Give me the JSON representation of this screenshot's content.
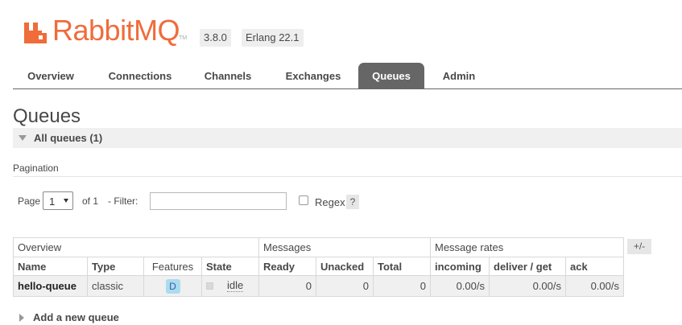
{
  "header": {
    "brand": "RabbitMQ",
    "trademark": "TM",
    "version": "3.8.0",
    "erlang": "Erlang 22.1",
    "brand_color": "#ef6c3b"
  },
  "tabs": [
    {
      "label": "Overview"
    },
    {
      "label": "Connections"
    },
    {
      "label": "Channels"
    },
    {
      "label": "Exchanges"
    },
    {
      "label": "Queues",
      "active": true
    },
    {
      "label": "Admin"
    }
  ],
  "page": {
    "title": "Queues",
    "section_label": "All queues (1)",
    "pagination_label": "Pagination"
  },
  "filter": {
    "page_label": "Page",
    "page_value": "1",
    "of_text": "of 1",
    "filter_label": "- Filter:",
    "filter_value": "",
    "regex_label": "Regex",
    "help_label": "?"
  },
  "table": {
    "groups": [
      "Overview",
      "Messages",
      "Message rates"
    ],
    "columns": [
      "Name",
      "Type",
      "Features",
      "State",
      "Ready",
      "Unacked",
      "Total",
      "incoming",
      "deliver / get",
      "ack"
    ],
    "rows": [
      {
        "name": "hello-queue",
        "type": "classic",
        "features": "D",
        "state": "idle",
        "ready": "0",
        "unacked": "0",
        "total": "0",
        "incoming": "0.00/s",
        "deliver_get": "0.00/s",
        "ack": "0.00/s"
      }
    ],
    "columns_toggle": "+/-"
  },
  "add_queue": {
    "label": "Add a new queue"
  },
  "colors": {
    "active_tab": "#666666",
    "feature_badge": "#aadcf0",
    "section_bg": "#f0f0f0"
  }
}
